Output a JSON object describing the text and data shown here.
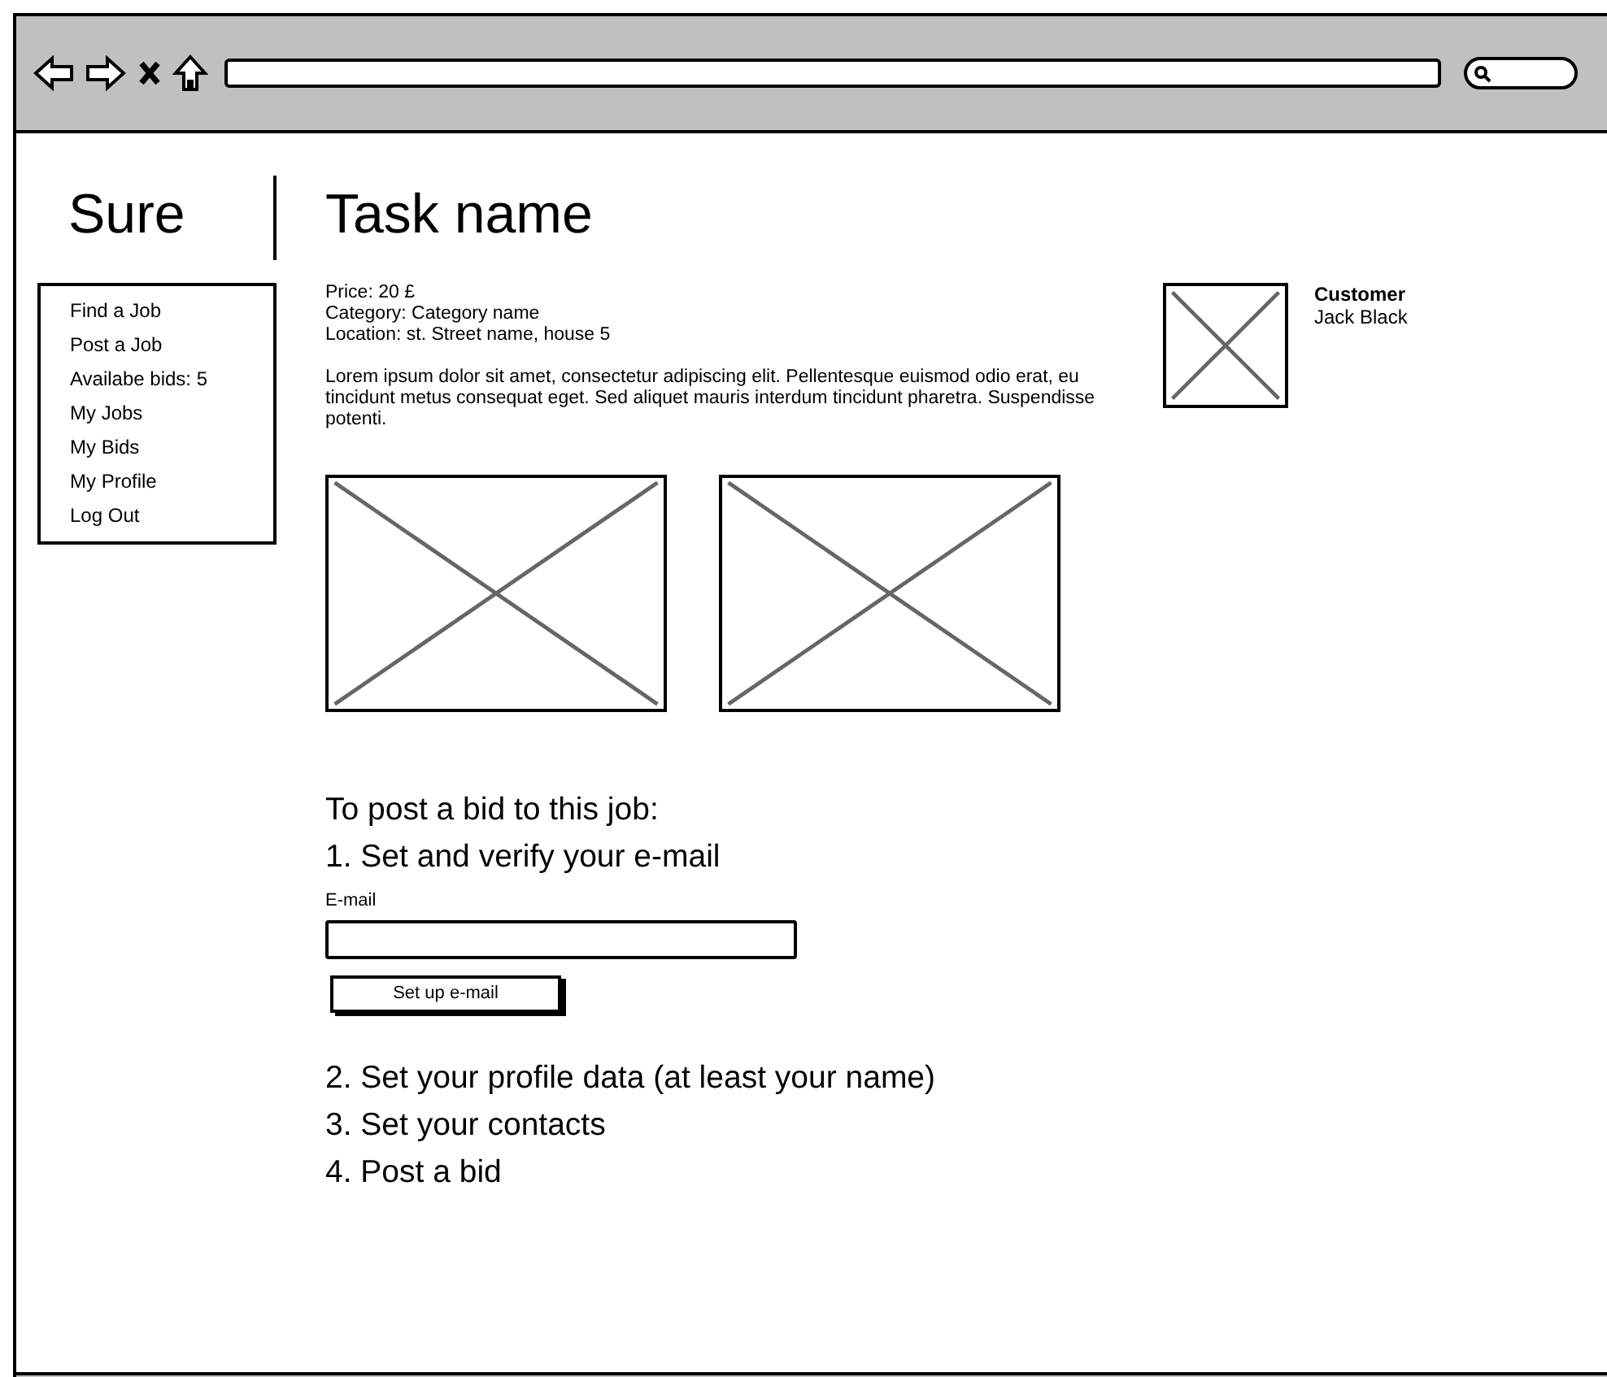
{
  "logo": "Sure",
  "nav": [
    {
      "label": "Find a Job"
    },
    {
      "label": "Post a Job"
    },
    {
      "label": "Availabe bids: 5"
    },
    {
      "label": "My Jobs"
    },
    {
      "label": "My Bids"
    },
    {
      "label": "My Profile"
    },
    {
      "label": "Log Out"
    }
  ],
  "task": {
    "title": "Task name",
    "details": [
      "Price: 20 £",
      "Category: Category name",
      "Location: st. Street name, house 5"
    ],
    "description": "Lorem ipsum dolor sit amet, consectetur adipiscing elit. Pellentesque euismod odio erat, eu tincidunt metus consequat eget. Sed aliquet mauris interdum tincidunt pharetra. Suspendisse potenti.",
    "customer": {
      "label": "Customer",
      "name": "Jack Black"
    }
  },
  "bid": {
    "heading": "To post a bid to this job:",
    "steps": [
      {
        "kind": "form",
        "text": "1. Set and verify your e-mail",
        "field_label": "E-mail",
        "button": "Set up e-mail"
      },
      {
        "kind": "text",
        "text": "2. Set your profile data (at least your name)"
      },
      {
        "kind": "text",
        "text": "3. Set your contacts"
      },
      {
        "kind": "text",
        "text": "4. Post a bid"
      }
    ]
  }
}
